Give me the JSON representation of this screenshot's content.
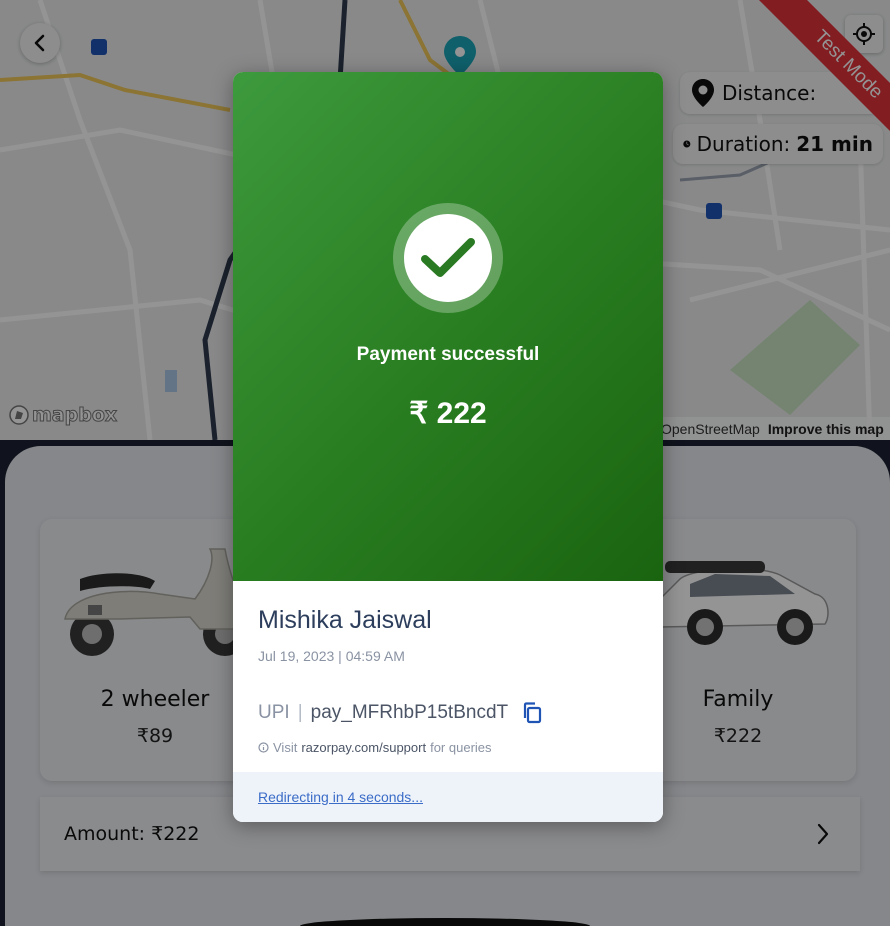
{
  "map": {
    "distance_label": "Distance:",
    "duration_label": "Duration:",
    "duration_value": "21 min",
    "mapbox_logo": "mapbox",
    "attribution_osm": "OpenStreetMap",
    "attribution_improve": "Improve this map",
    "test_mode": "Test Mode",
    "icons": [
      "chevron-left-icon",
      "locate-icon",
      "map-pin-icon",
      "clock-icon"
    ]
  },
  "sheet": {
    "vehicles": [
      {
        "name": "2 wheeler",
        "price": "₹89",
        "image": "scooter"
      },
      {
        "name": "Family",
        "price": "₹222",
        "image": "car"
      }
    ],
    "amount": "Amount: ₹222"
  },
  "payment": {
    "status": "Payment successful",
    "amount": "₹ 222",
    "payer_name": "Mishika Jaiswal",
    "date": "Jul 19, 2023 | 04:59 AM",
    "method": "UPI",
    "separator": "|",
    "payment_id": "pay_MFRhbP15tBncdT",
    "support_prefix": "Visit",
    "support_link": "razorpay.com/support",
    "support_suffix": "for queries",
    "redirect_text": "Redirecting in 4 seconds...",
    "colors": {
      "success_start": "#3d9a3d",
      "success_end": "#1a6410",
      "link": "#3b6cc7"
    }
  }
}
